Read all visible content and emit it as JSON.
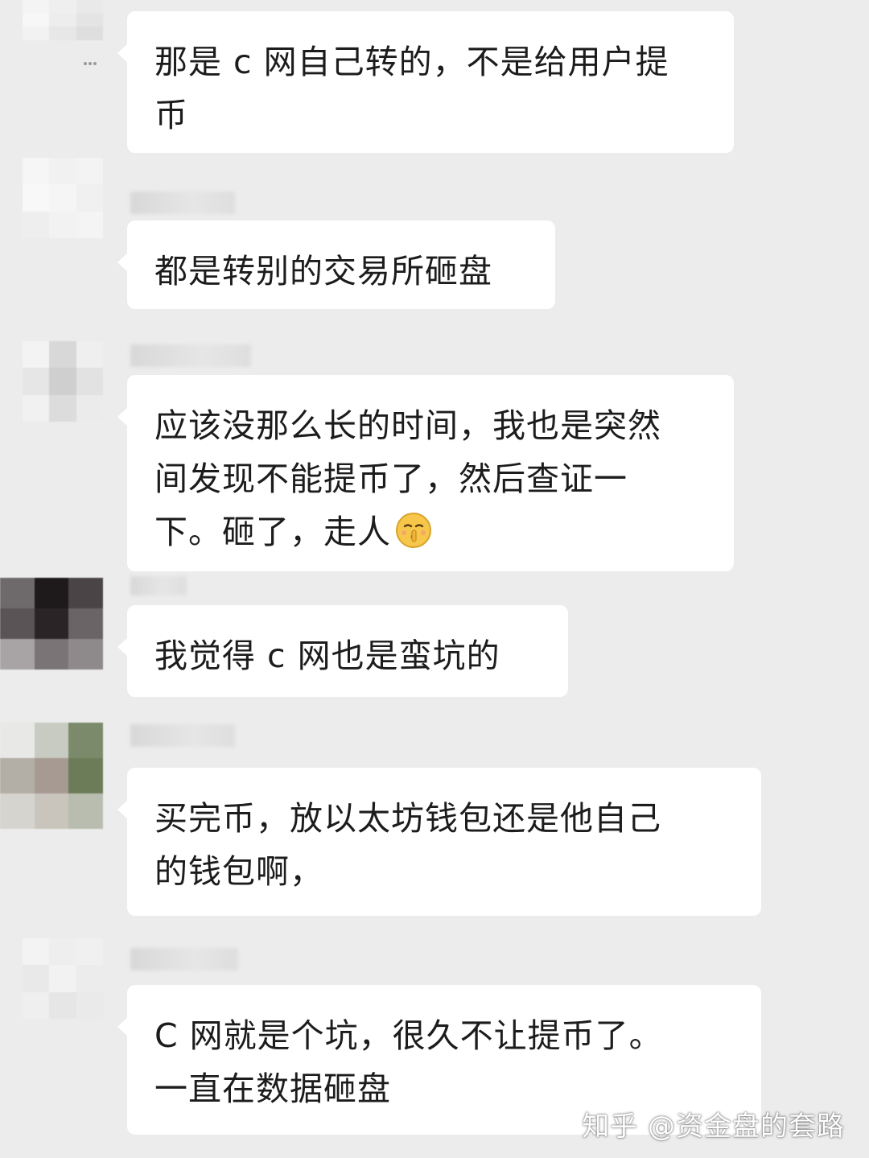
{
  "messages": [
    {
      "text": "那是 c 网自己转的，不是给用户提\n币",
      "avatar_colors": [
        "#f4f4f4",
        "#efefef",
        "#e9e9e9",
        "#f7f7f7",
        "#ededed",
        "#e4e4e4",
        "#f2f2f2",
        "#e7e7e7",
        "#dedede"
      ]
    },
    {
      "text": "都是转别的交易所砸盘",
      "avatar_colors": [
        "#f6f6f6",
        "#f1f1f1",
        "#f3f3f3",
        "#f8f8f8",
        "#f5f5f5",
        "#f0f0f0",
        "#eeeeee",
        "#f2f2f2",
        "#f4f4f4"
      ]
    },
    {
      "text": "应该没那么长的时间，我也是突然\n间发现不能提币了，然后查证一\n下。砸了，走人",
      "emoji": "shushing-face-icon",
      "avatar_colors": [
        "#f3f3f3",
        "#d8d8d8",
        "#efefef",
        "#e6e6e6",
        "#cfcfcf",
        "#e2e2e2",
        "#f1f1f1",
        "#dcdcdc",
        "#ebebeb"
      ]
    },
    {
      "text": "我觉得 c 网也是蛮坑的",
      "avatar_colors": [
        "#6e6a6c",
        "#1e1a1c",
        "#4a4446",
        "#5a5456",
        "#2a2426",
        "#6a6466",
        "#a8a4a6",
        "#7a7476",
        "#8e8a8c"
      ]
    },
    {
      "text": "买完币，放以太坊钱包还是他自己\n的钱包啊，",
      "avatar_colors": [
        "#e8e8e6",
        "#c8cbc2",
        "#7a8a6a",
        "#b3aea6",
        "#a79a92",
        "#6d7c58",
        "#d6d4cf",
        "#c9c5bd",
        "#b8bdb0"
      ]
    },
    {
      "text": "C 网就是个坑，很久不让提币了。\n一直在数据砸盘",
      "avatar_colors": [
        "#f3f3f3",
        "#eeeeee",
        "#f0f0f0",
        "#e9e9e9",
        "#f2f2f2",
        "#ececec",
        "#efefef",
        "#e6e6e6",
        "#eaeaea"
      ]
    }
  ],
  "watermark": "知乎 @资金盘的套路"
}
